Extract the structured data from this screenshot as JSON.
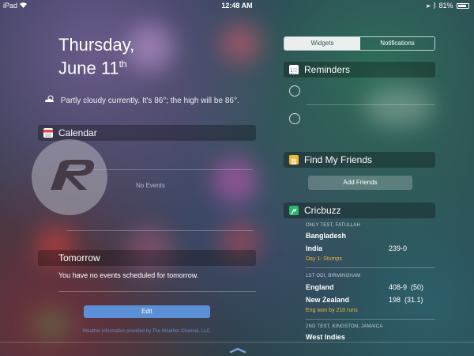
{
  "status_bar": {
    "carrier": "iPad",
    "time": "12:48 AM",
    "battery": "81%",
    "battery_level": 0.81
  },
  "today": {
    "weekday": "Thursday,",
    "date_main": "June 11",
    "date_suffix": "th",
    "weather_text": "Partly cloudy currently. It's 86°; the high will be 86°.",
    "weather_icon": "partly-cloudy-icon"
  },
  "calendar": {
    "title": "Calendar",
    "icon": "calendar-icon",
    "empty_text": "No Events"
  },
  "tomorrow": {
    "title": "Tomorrow",
    "text": "You have no events scheduled for tomorrow."
  },
  "edit_label": "Edit",
  "weather_credit": "Weather information provided by The Weather Channel, LLC.",
  "segment": {
    "tabs": [
      "Widgets",
      "Notifications"
    ],
    "selected": "Widgets"
  },
  "reminders": {
    "title": "Reminders",
    "icon": "reminders-icon",
    "item_count": 2
  },
  "find_my_friends": {
    "title": "Find My Friends",
    "icon": "friends-icon",
    "button": "Add Friends"
  },
  "cricbuzz": {
    "title": "Cricbuzz",
    "icon": "cricbuzz-icon",
    "matches": [
      {
        "subtitle": "ONLY TEST, FATULLAH",
        "teams": [
          {
            "name": "Bangladesh",
            "score": ""
          },
          {
            "name": "India",
            "score": "239-0"
          }
        ],
        "result": "Day 1: Stumps"
      },
      {
        "subtitle": "1ST ODI, BIRMINGHAM",
        "teams": [
          {
            "name": "England",
            "score": "408-9  (50)"
          },
          {
            "name": "New Zealand",
            "score": "198  (31.1)"
          }
        ],
        "result": "Eng won by 210 runs"
      },
      {
        "subtitle": "2ND TEST, KINGSTON, JAMAICA",
        "teams": [
          {
            "name": "West Indies",
            "score": ""
          }
        ],
        "result": ""
      }
    ]
  },
  "colors": {
    "accent_green": "#4fc78e",
    "edit_blue": "#5b8fd6",
    "result_orange": "#f0b43c"
  }
}
